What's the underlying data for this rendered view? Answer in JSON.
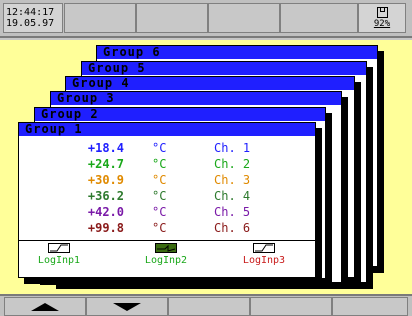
{
  "header": {
    "time": "12:44:17",
    "date": "19.05.97",
    "memory_percent": "92%"
  },
  "groups": [
    "Group 6",
    "Group 5",
    "Group 4",
    "Group 3",
    "Group 2",
    "Group 1"
  ],
  "active_group": {
    "title": "Group 1",
    "rows": [
      {
        "value": "+18.4",
        "unit": "°C",
        "channel": "Ch. 1",
        "color": "#1f1fff"
      },
      {
        "value": "+24.7",
        "unit": "°C",
        "channel": "Ch. 2",
        "color": "#1aa81a"
      },
      {
        "value": "+30.9",
        "unit": "°C",
        "channel": "Ch. 3",
        "color": "#e08a00"
      },
      {
        "value": "+36.2",
        "unit": "°C",
        "channel": "Ch. 4",
        "color": "#2e7a2e"
      },
      {
        "value": "+42.0",
        "unit": "°C",
        "channel": "Ch. 5",
        "color": "#7a1aa8"
      },
      {
        "value": "+99.8",
        "unit": "°C",
        "channel": "Ch. 6",
        "color": "#8a1a1a"
      }
    ],
    "log_inputs": [
      {
        "label": "LogInp1",
        "color": "#1aa81a",
        "active": false
      },
      {
        "label": "LogInp2",
        "color": "#1aa81a",
        "active": true
      },
      {
        "label": "LogInp3",
        "color": "#c81a1a",
        "active": false
      }
    ]
  },
  "footer": {
    "up_icon": "arrow-up-icon",
    "down_icon": "arrow-down-icon"
  }
}
